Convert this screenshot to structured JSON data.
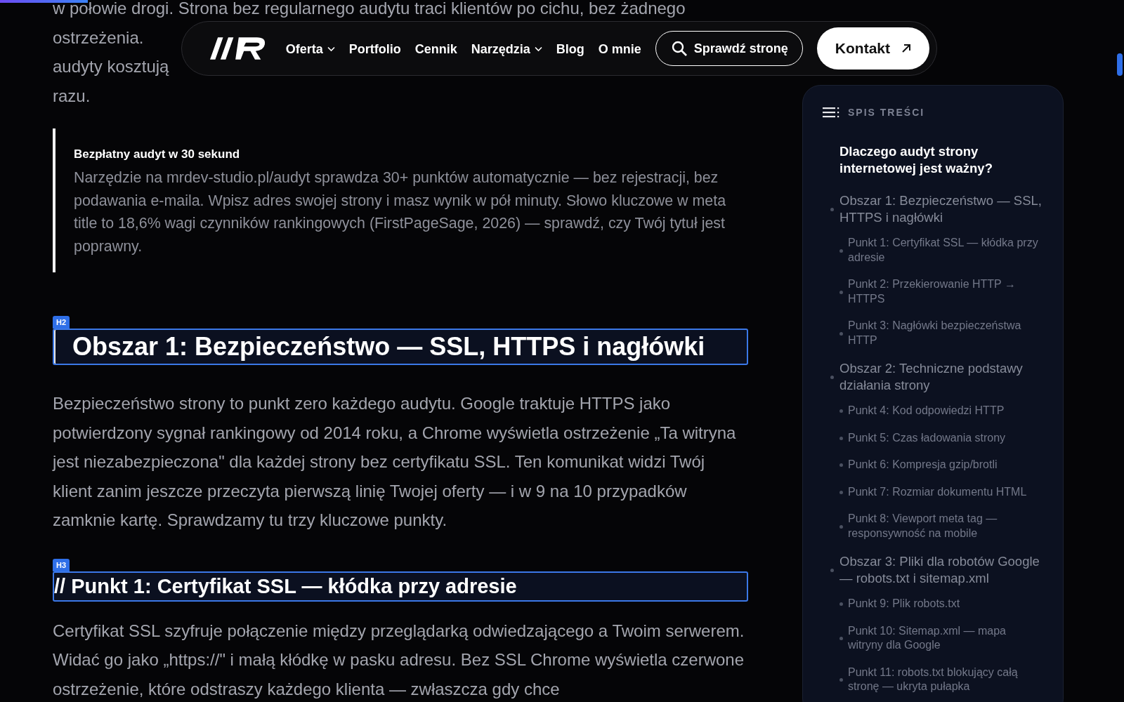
{
  "reading_progress": {
    "level": 0.078
  },
  "nav": {
    "items": [
      {
        "label": "Oferta",
        "dropdown": true
      },
      {
        "label": "Portfolio",
        "dropdown": false
      },
      {
        "label": "Cennik",
        "dropdown": false
      },
      {
        "label": "Narzędzia",
        "dropdown": true
      },
      {
        "label": "Blog",
        "dropdown": false
      },
      {
        "label": "O mnie",
        "dropdown": false
      }
    ],
    "check_button": "Sprawdź stronę",
    "contact_button": "Kontakt"
  },
  "article": {
    "blocks": [
      {
        "kind": "covered_paragraph",
        "lines": [
          "w połowie drogi. Strona bez regularnego audytu traci klientów po cichu, bez żadnego",
          "ostrzeżenia.",
          "audyty kosztują",
          "razu."
        ]
      },
      {
        "kind": "callout",
        "title": "Bezpłatny audyt w 30 sekund",
        "text": "Narzędzie na mrdev-studio.pl/audyt sprawdza 30+ punktów automatycznie — bez rejestracji, bez podawania e-maila. Wpisz adres swojej strony i masz wynik w pół minuty. Słowo kluczowe w meta title to 18,6% wagi czynników rankingowych (FirstPageSage, 2026) — sprawdź, czy Twój tytuł jest poprawny."
      },
      {
        "kind": "h2",
        "badge": "H2",
        "text": "Obszar 1: Bezpieczeństwo — SSL, HTTPS i nagłówki"
      },
      {
        "kind": "paragraph",
        "text": "Bezpieczeństwo strony to punkt zero każdego audytu. Google traktuje HTTPS jako potwierdzony sygnał rankingowy od 2014 roku, a Chrome wyświetla ostrzeżenie „Ta witryna jest niezabezpieczona\" dla każdej strony bez certyfikatu SSL. Ten komunikat widzi Twój klient zanim jeszcze przeczyta pierwszą linię Twojej oferty — i w 9 na 10 przypadków zamknie kartę. Sprawdzamy tu trzy kluczowe punkty."
      },
      {
        "kind": "h3",
        "badge": "H3",
        "text": "// Punkt 1: Certyfikat SSL — kłódka przy adresie"
      },
      {
        "kind": "paragraph",
        "text": "Certyfikat SSL szyfruje połączenie między przeglądarką odwiedzającego a Twoim serwerem. Widać go jako „https://\" i małą kłódkę w pasku adresu. Bez SSL Chrome wyświetla czerwone ostrzeżenie, które odstraszy każdego klienta — zwłaszcza gdy chce"
      }
    ]
  },
  "toc": {
    "title": "SPIS TREŚCI",
    "items": [
      {
        "label": "Dlaczego audyt strony internetowej jest ważny?",
        "selected": true
      },
      {
        "label": "Obszar 1: Bezpieczeństwo — SSL, HTTPS i nagłówki",
        "selected": false,
        "children": [
          {
            "label": "Punkt 1: Certyfikat SSL — kłódka przy adresie",
            "selected": false
          },
          {
            "label": "Punkt 2: Przekierowanie HTTP → HTTPS",
            "selected": false
          },
          {
            "label": "Punkt 3: Nagłówki bezpieczeństwa HTTP",
            "selected": false
          }
        ]
      },
      {
        "label": "Obszar 2: Techniczne podstawy działania strony",
        "selected": false,
        "children": [
          {
            "label": "Punkt 4: Kod odpowiedzi HTTP",
            "selected": false
          },
          {
            "label": "Punkt 5: Czas ładowania strony",
            "selected": false
          },
          {
            "label": "Punkt 6: Kompresja gzip/brotli",
            "selected": false
          },
          {
            "label": "Punkt 7: Rozmiar dokumentu HTML",
            "selected": false
          },
          {
            "label": "Punkt 8: Viewport meta tag — responsywność na mobile",
            "selected": false
          }
        ]
      },
      {
        "label": "Obszar 3: Pliki dla robotów Google — robots.txt i sitemap.xml",
        "selected": false,
        "children": [
          {
            "label": "Punkt 9: Plik robots.txt",
            "selected": false
          },
          {
            "label": "Punkt 10: Sitemap.xml — mapa witryny dla Google",
            "selected": false
          },
          {
            "label": "Punkt 11: robots.txt blokujący całą stronę — ukryta pułapka",
            "selected": false
          }
        ]
      }
    ]
  }
}
